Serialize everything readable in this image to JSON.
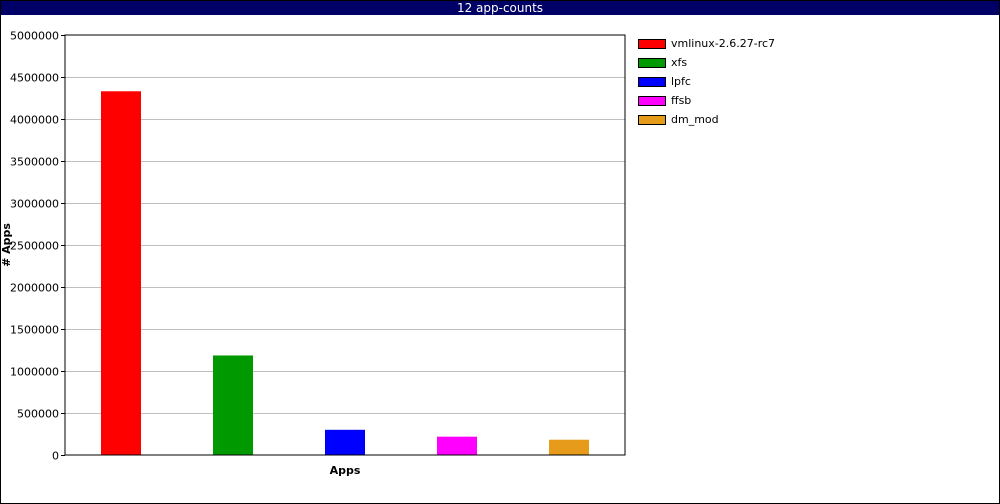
{
  "window": {
    "title": "12 app-counts"
  },
  "chart_data": {
    "type": "bar",
    "title": "12 app-counts",
    "xlabel": "Apps",
    "ylabel": "# Apps",
    "categories": [
      "vmlinux-2.6.27-rc7",
      "xfs",
      "lpfc",
      "ffsb",
      "dm_mod"
    ],
    "values": [
      4330000,
      1185000,
      300000,
      218000,
      182000
    ],
    "colors": [
      "#ff0000",
      "#009900",
      "#0000ff",
      "#ff00ff",
      "#e69c1a"
    ],
    "ylim": [
      0,
      5000000
    ],
    "yticks": [
      0,
      500000,
      1000000,
      1500000,
      2000000,
      2500000,
      3000000,
      3500000,
      4000000,
      4500000,
      5000000
    ],
    "grid": true,
    "legend_position": "right"
  }
}
